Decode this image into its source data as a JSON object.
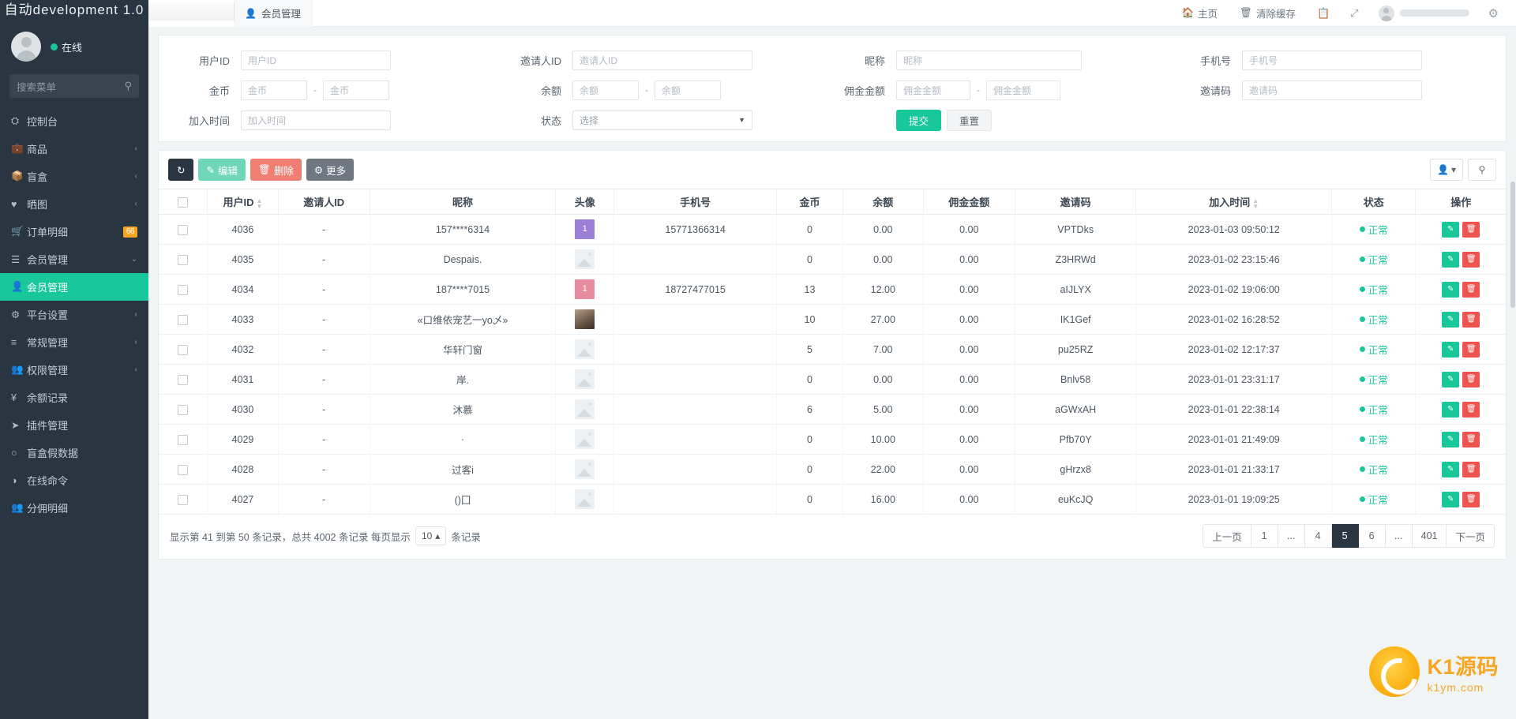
{
  "brand": {
    "title": "自动development 1.0"
  },
  "sidebar": {
    "online_label": "在线",
    "search_placeholder": "搜索菜单",
    "search_icon": "search-icon",
    "items": [
      {
        "label": "控制台",
        "icon": "dashboard-icon",
        "caret": "",
        "badge": "",
        "active": false
      },
      {
        "label": "商品",
        "icon": "briefcase-icon",
        "caret": "‹",
        "badge": "",
        "active": false
      },
      {
        "label": "盲盒",
        "icon": "box-icon",
        "caret": "‹",
        "badge": "",
        "active": false
      },
      {
        "label": "晒图",
        "icon": "heart-icon",
        "caret": "‹",
        "badge": "",
        "active": false
      },
      {
        "label": "订单明细",
        "icon": "cart-icon",
        "caret": "",
        "badge": "66",
        "active": false
      },
      {
        "label": "会员管理",
        "icon": "list-icon",
        "caret": "⌄",
        "badge": "",
        "active": false
      },
      {
        "label": "会员管理",
        "icon": "user-icon",
        "caret": "",
        "badge": "",
        "active": true
      },
      {
        "label": "平台设置",
        "icon": "gear-icon",
        "caret": "‹",
        "badge": "",
        "active": false
      },
      {
        "label": "常规管理",
        "icon": "database-icon",
        "caret": "‹",
        "badge": "",
        "active": false
      },
      {
        "label": "权限管理",
        "icon": "users-icon",
        "caret": "‹",
        "badge": "",
        "active": false
      },
      {
        "label": "余额记录",
        "icon": "yen-icon",
        "caret": "",
        "badge": "",
        "active": false
      },
      {
        "label": "插件管理",
        "icon": "rocket-icon",
        "caret": "",
        "badge": "",
        "active": false
      },
      {
        "label": "盲盒假数据",
        "icon": "circle-icon",
        "caret": "",
        "badge": "",
        "active": false
      },
      {
        "label": "在线命令",
        "icon": "halfcircle-icon",
        "caret": "",
        "badge": "",
        "active": false
      },
      {
        "label": "分佣明细",
        "icon": "users-icon",
        "caret": "",
        "badge": "",
        "active": false
      }
    ]
  },
  "topbar": {
    "tab_label": "会员管理",
    "tab_icon": "user-icon",
    "home_label": "主页",
    "home_icon": "home-icon",
    "clear_cache_label": "清除缓存",
    "clear_cache_icon": "trash-icon",
    "note_icon": "note-icon",
    "fullscreen_icon": "fullscreen-icon",
    "gear_icon": "gear-icon"
  },
  "search_form": {
    "row1": [
      {
        "label": "用户ID",
        "placeholder": "用户ID",
        "value": "",
        "name": "user-id"
      },
      {
        "label": "邀请人ID",
        "placeholder": "邀请人ID",
        "value": "",
        "name": "inviter-id"
      },
      {
        "label": "昵称",
        "placeholder": "昵称",
        "value": "",
        "name": "nickname"
      },
      {
        "label": "手机号",
        "placeholder": "手机号",
        "value": "",
        "name": "phone"
      }
    ],
    "row2": [
      {
        "label": "金币",
        "placeholder_from": "金币",
        "placeholder_to": "金币",
        "name": "coins"
      },
      {
        "label": "余额",
        "placeholder_from": "余额",
        "placeholder_to": "余额",
        "name": "balance"
      },
      {
        "label": "佣金金额",
        "placeholder_from": "佣金金额",
        "placeholder_to": "佣金金额",
        "name": "commission"
      }
    ],
    "row2_single": {
      "label": "邀请码",
      "placeholder": "邀请码",
      "name": "invite-code"
    },
    "row3": {
      "join_time_label": "加入时间",
      "join_time_placeholder": "加入时间",
      "status_label": "状态",
      "status_value": "选择",
      "submit_label": "提交",
      "reset_label": "重置"
    },
    "separator": "-"
  },
  "toolbar": {
    "refresh_icon": "refresh-icon",
    "edit_label": "编辑",
    "edit_icon": "pencil-icon",
    "delete_label": "删除",
    "delete_icon": "trash-icon",
    "more_label": "更多",
    "more_icon": "gear-icon",
    "columns_icon": "columns-icon",
    "columns_caret": "▾",
    "search_icon": "search-icon"
  },
  "table": {
    "columns": [
      "用户ID",
      "邀请人ID",
      "昵称",
      "头像",
      "手机号",
      "金币",
      "余额",
      "佣金金额",
      "邀请码",
      "加入时间",
      "状态",
      "操作"
    ],
    "sortable": [
      "用户ID",
      "加入时间"
    ],
    "rows": [
      {
        "id": "4036",
        "inviter": "-",
        "nickname": "157****6314",
        "avatar_type": "purple",
        "avatar_text": "1",
        "phone": "15771366314",
        "coins": "0",
        "balance": "0.00",
        "commission": "0.00",
        "code": "VPTDks",
        "join": "2023-01-03 09:50:12",
        "status": "正常"
      },
      {
        "id": "4035",
        "inviter": "-",
        "nickname": "Despais.",
        "avatar_type": "placeholder",
        "avatar_text": "",
        "phone": "",
        "coins": "0",
        "balance": "0.00",
        "commission": "0.00",
        "code": "Z3HRWd",
        "join": "2023-01-02 23:15:46",
        "status": "正常"
      },
      {
        "id": "4034",
        "inviter": "-",
        "nickname": "187****7015",
        "avatar_type": "pink",
        "avatar_text": "1",
        "phone": "18727477015",
        "coins": "13",
        "balance": "12.00",
        "commission": "0.00",
        "code": "aIJLYX",
        "join": "2023-01-02 19:06:00",
        "status": "正常"
      },
      {
        "id": "4033",
        "inviter": "-",
        "nickname": "«口维依宠艺一yo乄»",
        "avatar_type": "photo",
        "avatar_text": "",
        "phone": "",
        "coins": "10",
        "balance": "27.00",
        "commission": "0.00",
        "code": "IK1Gef",
        "join": "2023-01-02 16:28:52",
        "status": "正常"
      },
      {
        "id": "4032",
        "inviter": "-",
        "nickname": "华轩门窗",
        "avatar_type": "placeholder",
        "avatar_text": "",
        "phone": "",
        "coins": "5",
        "balance": "7.00",
        "commission": "0.00",
        "code": "pu25RZ",
        "join": "2023-01-02 12:17:37",
        "status": "正常"
      },
      {
        "id": "4031",
        "inviter": "-",
        "nickname": "岸.",
        "avatar_type": "placeholder",
        "avatar_text": "",
        "phone": "",
        "coins": "0",
        "balance": "0.00",
        "commission": "0.00",
        "code": "Bnlv58",
        "join": "2023-01-01 23:31:17",
        "status": "正常"
      },
      {
        "id": "4030",
        "inviter": "-",
        "nickname": "沐慕",
        "avatar_type": "placeholder",
        "avatar_text": "",
        "phone": "",
        "coins": "6",
        "balance": "5.00",
        "commission": "0.00",
        "code": "aGWxAH",
        "join": "2023-01-01 22:38:14",
        "status": "正常"
      },
      {
        "id": "4029",
        "inviter": "-",
        "nickname": "·",
        "avatar_type": "placeholder",
        "avatar_text": "",
        "phone": "",
        "coins": "0",
        "balance": "10.00",
        "commission": "0.00",
        "code": "Pfb70Y",
        "join": "2023-01-01 21:49:09",
        "status": "正常"
      },
      {
        "id": "4028",
        "inviter": "-",
        "nickname": "过客i",
        "avatar_type": "placeholder",
        "avatar_text": "",
        "phone": "",
        "coins": "0",
        "balance": "22.00",
        "commission": "0.00",
        "code": "gHrzx8",
        "join": "2023-01-01 21:33:17",
        "status": "正常"
      },
      {
        "id": "4027",
        "inviter": "-",
        "nickname": "()囗",
        "avatar_type": "placeholder",
        "avatar_text": "",
        "phone": "",
        "coins": "0",
        "balance": "16.00",
        "commission": "0.00",
        "code": "euKcJQ",
        "join": "2023-01-01 19:09:25",
        "status": "正常"
      }
    ],
    "row_action_edit_icon": "pencil-icon",
    "row_action_delete_icon": "trash-icon"
  },
  "footer": {
    "info_prefix": "显示第 41 到第 50 条记录，总共 4002 条记录 每页显示",
    "page_size": "10",
    "page_size_caret": "▴",
    "info_suffix": "条记录",
    "pages": [
      "上一页",
      "1",
      "...",
      "4",
      "5",
      "6",
      "...",
      "401",
      "下一页"
    ],
    "current_page": "5"
  },
  "watermark": {
    "text": "K1源码",
    "sub": "k1ym.com"
  }
}
